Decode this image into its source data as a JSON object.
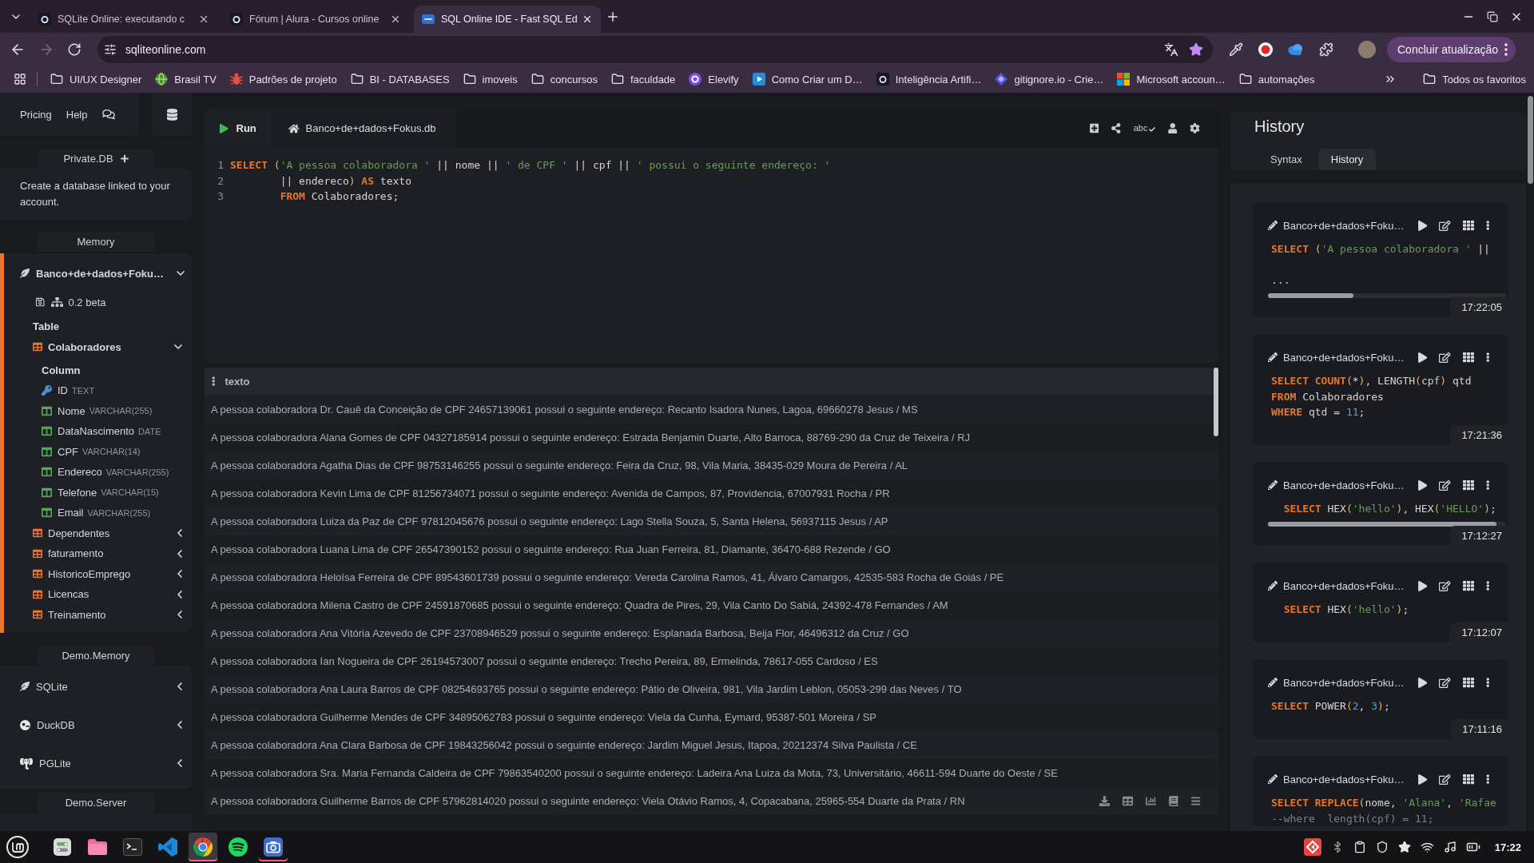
{
  "browser": {
    "tabs": [
      {
        "title": "SQLite Online: executando c",
        "kind": "tile",
        "selected": false
      },
      {
        "title": "Fórum | Alura - Cursos online",
        "kind": "tile",
        "selected": false
      },
      {
        "title": "SQL Online IDE - Fast SQL Ed",
        "kind": "badge",
        "selected": true
      }
    ],
    "forward_disabled": true,
    "address": {
      "url": "sqliteonline.com",
      "bookmarked": true
    },
    "update_button": "Concluir atualização",
    "bookmarks": [
      {
        "label": "UI/UX Designer",
        "kind": "folder"
      },
      {
        "label": "Brasil TV",
        "kind": "globe"
      },
      {
        "label": "Padrões de projeto",
        "kind": "bug"
      },
      {
        "label": "BI - DATABASES",
        "kind": "folder"
      },
      {
        "label": "imoveis",
        "kind": "folder"
      },
      {
        "label": "concursos",
        "kind": "folder"
      },
      {
        "label": "faculdade",
        "kind": "folder"
      },
      {
        "label": "Elevify",
        "kind": "ring"
      },
      {
        "label": "Como Criar um D…",
        "kind": "play"
      },
      {
        "label": "Inteligência Artifi…",
        "kind": "tile"
      },
      {
        "label": "gitignore.io - Crie…",
        "kind": "diamond"
      },
      {
        "label": "Microsoft accoun…",
        "kind": "squares"
      },
      {
        "label": "automações",
        "kind": "folder"
      }
    ],
    "all_bookmarks": "Todos os favoritos"
  },
  "sidebar": {
    "links": [
      "Pricing",
      "Help"
    ],
    "private_db": {
      "title": "Private.DB",
      "text": "Create a database linked to your account."
    },
    "memory": {
      "title": "Memory",
      "database": {
        "name": "Banco+de+dados+Foku…",
        "selected": true,
        "expanded": true,
        "version": "0.2 beta",
        "tables_heading": "Table",
        "tables": [
          {
            "name": "Colaboradores",
            "expanded": true,
            "columns_heading": "Column",
            "columns": [
              {
                "name": "ID",
                "type": "TEXT",
                "kind": "key"
              },
              {
                "name": "Nome",
                "type": "VARCHAR(255)",
                "kind": "field"
              },
              {
                "name": "DataNascimento",
                "type": "DATE",
                "kind": "field"
              },
              {
                "name": "CPF",
                "type": "VARCHAR(14)",
                "kind": "field"
              },
              {
                "name": "Endereco",
                "type": "VARCHAR(255)",
                "kind": "field"
              },
              {
                "name": "Telefone",
                "type": "VARCHAR(15)",
                "kind": "field"
              },
              {
                "name": "Email",
                "type": "VARCHAR(255)",
                "kind": "field"
              }
            ]
          },
          {
            "name": "Dependentes",
            "expanded": false
          },
          {
            "name": "faturamento",
            "expanded": false
          },
          {
            "name": "HistoricoEmprego",
            "expanded": false
          },
          {
            "name": "Licencas",
            "expanded": false
          },
          {
            "name": "Treinamento",
            "expanded": false
          }
        ]
      }
    },
    "demo_memory": {
      "title": "Demo.Memory",
      "engines": [
        {
          "name": "SQLite",
          "kind": "feather",
          "expanded": false
        },
        {
          "name": "DuckDB",
          "kind": "disc",
          "expanded": false
        },
        {
          "name": "PGLite",
          "kind": "elephant",
          "expanded": false
        }
      ]
    },
    "demo_server": {
      "title": "Demo.Server"
    }
  },
  "editor": {
    "run_button": "Run",
    "file_tab": "Banco+de+dados+Fokus.db",
    "tools": [
      {
        "kind": "add"
      },
      {
        "kind": "share"
      },
      {
        "kind": "spellcheck",
        "label": "abc"
      },
      {
        "kind": "user"
      },
      {
        "kind": "settings"
      }
    ],
    "lines": [
      {
        "number": "1",
        "tokens": [
          {
            "text": "SELECT",
            "kind": "keyword"
          },
          {
            "text": " (",
            "kind": "bracket"
          },
          {
            "text": "'A pessoa colaboradora '",
            "kind": "string"
          },
          {
            "text": " || nome || ",
            "kind": "plain"
          },
          {
            "text": "' de CPF '",
            "kind": "string"
          },
          {
            "text": " || cpf || ",
            "kind": "plain"
          },
          {
            "text": "' possui o seguinte endereço: '",
            "kind": "string"
          }
        ]
      },
      {
        "number": "2",
        "tokens": [
          {
            "text": "        || endereco",
            "kind": "plain"
          },
          {
            "text": ")",
            "kind": "bracket"
          },
          {
            "text": " AS",
            "kind": "keyword"
          },
          {
            "text": " texto",
            "kind": "plain"
          }
        ]
      },
      {
        "number": "3",
        "tokens": [
          {
            "text": "        FROM",
            "kind": "keyword"
          },
          {
            "text": " Colaboradores;",
            "kind": "plain"
          }
        ]
      }
    ]
  },
  "results": {
    "column": "texto",
    "rows": [
      "A pessoa colaboradora Dr. Cauê da Conceição de CPF 24657139061 possui o seguinte endereço: Recanto Isadora Nunes, Lagoa, 69660278 Jesus / MS",
      "A pessoa colaboradora Alana Gomes de CPF 04327185914 possui o seguinte endereço: Estrada Benjamin Duarte, Alto Barroca, 88769-290 da Cruz de Teixeira / RJ",
      "A pessoa colaboradora Agatha Dias de CPF 98753146255 possui o seguinte endereço: Feira da Cruz, 98, Vila Maria, 38435-029 Moura de Pereira / AL",
      "A pessoa colaboradora Kevin Lima de CPF 81256734071 possui o seguinte endereço: Avenida de Campos, 87, Providencia, 67007931 Rocha / PR",
      "A pessoa colaboradora Luiza da Paz de CPF 97812045676 possui o seguinte endereço: Lago Stella Souza, 5, Santa Helena, 56937115 Jesus / AP",
      "A pessoa colaboradora Luana Lima de CPF 26547390152 possui o seguinte endereço: Rua Juan Ferreira, 81, Diamante, 36470-688 Rezende / GO",
      "A pessoa colaboradora Heloísa Ferreira de CPF 89543601739 possui o seguinte endereço: Vereda Carolina Ramos, 41, Álvaro Camargos, 42535-583 Rocha de Goiás / PE",
      "A pessoa colaboradora Milena Castro de CPF 24591870685 possui o seguinte endereço: Quadra de Pires, 29, Vila Canto Do Sabiá, 24392-478 Fernandes / AM",
      "A pessoa colaboradora Ana Vitória Azevedo de CPF 23708946529 possui o seguinte endereço: Esplanada Barbosa, Beija Flor, 46496312 da Cruz / GO",
      "A pessoa colaboradora Ian Nogueira de CPF 26194573007 possui o seguinte endereço: Trecho Pereira, 89, Ermelinda, 78617-055 Cardoso / ES",
      "A pessoa colaboradora Ana Laura Barros de CPF 08254693765 possui o seguinte endereço: Pátio de Oliveira, 981, Vila Jardim Leblon, 05053-299 das Neves / TO",
      "A pessoa colaboradora Guilherme Mendes de CPF 34895062783 possui o seguinte endereço: Viela da Cunha, Eymard, 95387-501 Moreira / SP",
      "A pessoa colaboradora Ana Clara Barbosa de CPF 19843256042 possui o seguinte endereço: Jardim Miguel Jesus, Itapoa, 20212374 Silva Paulista / CE",
      "A pessoa colaboradora Sra. Maria Fernanda Caldeira de CPF 79863540200 possui o seguinte endereço: Ladeira Ana Luiza da Mota, 73, Universitário, 46611-594 Duarte do Oeste / SE",
      "A pessoa colaboradora Guilherme Barros de CPF 57962814020 possui o seguinte endereço: Viela Otávio Ramos, 4, Copacabana, 25965-554 Duarte da Prata / RN"
    ],
    "tools": [
      {
        "kind": "download"
      },
      {
        "kind": "table"
      },
      {
        "kind": "chart"
      },
      {
        "kind": "book"
      },
      {
        "kind": "menu"
      }
    ]
  },
  "history": {
    "title": "History",
    "tabs": [
      {
        "label": "Syntax",
        "selected": false
      },
      {
        "label": "History",
        "selected": true
      }
    ],
    "entries": [
      {
        "database": "Banco+de+dados+Foku…",
        "scrollbar": true,
        "time": "17:22:05",
        "more": "...",
        "lines": [
          [
            {
              "text": "SELECT",
              "kind": "keyword"
            },
            {
              "text": " (",
              "kind": "bracket"
            },
            {
              "text": "'A pessoa colaboradora '",
              "kind": "string"
            },
            {
              "text": " ||",
              "kind": "plain"
            }
          ]
        ]
      },
      {
        "database": "Banco+de+dados+Foku…",
        "scrollbar": false,
        "time": "17:21:36",
        "lines": [
          [
            {
              "text": "SELECT",
              "kind": "keyword"
            },
            {
              "text": " COUNT",
              "kind": "keyword"
            },
            {
              "text": "(",
              "kind": "bracket"
            },
            {
              "text": "*",
              "kind": "plain"
            },
            {
              "text": ")",
              "kind": "bracket"
            },
            {
              "text": ", LENGTH",
              "kind": "plain"
            },
            {
              "text": "(",
              "kind": "bracket"
            },
            {
              "text": "cpf",
              "kind": "plain"
            },
            {
              "text": ")",
              "kind": "bracket"
            },
            {
              "text": " qtd",
              "kind": "plain"
            }
          ],
          [
            {
              "text": "FROM",
              "kind": "keyword"
            },
            {
              "text": " Colaboradores",
              "kind": "plain"
            }
          ],
          [
            {
              "text": "WHERE",
              "kind": "keyword"
            },
            {
              "text": " qtd = ",
              "kind": "plain"
            },
            {
              "text": "11",
              "kind": "number"
            },
            {
              "text": ";",
              "kind": "plain"
            }
          ]
        ]
      },
      {
        "database": "Banco+de+dados+Foku…",
        "scrollbar": true,
        "time": "17:12:27",
        "lines": [
          [
            {
              "text": "  SELECT",
              "kind": "keyword"
            },
            {
              "text": " HEX",
              "kind": "plain"
            },
            {
              "text": "(",
              "kind": "bracket"
            },
            {
              "text": "'hello'",
              "kind": "string"
            },
            {
              "text": ")",
              "kind": "bracket"
            },
            {
              "text": ", HEX",
              "kind": "plain"
            },
            {
              "text": "(",
              "kind": "bracket"
            },
            {
              "text": "'HELLO'",
              "kind": "string"
            },
            {
              "text": ")",
              "kind": "bracket"
            },
            {
              "text": ";",
              "kind": "plain"
            }
          ]
        ]
      },
      {
        "database": "Banco+de+dados+Foku…",
        "scrollbar": false,
        "time": "17:12:07",
        "lines": [
          [
            {
              "text": "  SELECT",
              "kind": "keyword"
            },
            {
              "text": " HEX",
              "kind": "plain"
            },
            {
              "text": "(",
              "kind": "bracket"
            },
            {
              "text": "'hello'",
              "kind": "string"
            },
            {
              "text": ")",
              "kind": "bracket"
            },
            {
              "text": ";",
              "kind": "plain"
            }
          ]
        ]
      },
      {
        "database": "Banco+de+dados+Foku…",
        "scrollbar": false,
        "time": "17:11:16",
        "lines": [
          [
            {
              "text": "SELECT",
              "kind": "keyword"
            },
            {
              "text": " POWER",
              "kind": "plain"
            },
            {
              "text": "(",
              "kind": "bracket"
            },
            {
              "text": "2",
              "kind": "number"
            },
            {
              "text": ", ",
              "kind": "plain"
            },
            {
              "text": "3",
              "kind": "number"
            },
            {
              "text": ")",
              "kind": "bracket"
            },
            {
              "text": ";",
              "kind": "plain"
            }
          ]
        ]
      },
      {
        "database": "Banco+de+dados+Foku…",
        "scrollbar": false,
        "lines": [
          [
            {
              "text": "SELECT",
              "kind": "keyword"
            },
            {
              "text": " REPLACE",
              "kind": "keyword"
            },
            {
              "text": "(",
              "kind": "bracket"
            },
            {
              "text": "nome, ",
              "kind": "plain"
            },
            {
              "text": "'Alana'",
              "kind": "string"
            },
            {
              "text": ", ",
              "kind": "plain"
            },
            {
              "text": "'Rafae",
              "kind": "string"
            }
          ],
          [
            {
              "text": "--where  length(cpf) = 11;",
              "kind": "comment"
            }
          ]
        ]
      }
    ]
  },
  "taskbar": {
    "apps": [
      {
        "kind": "settings",
        "selected": false,
        "running": false
      },
      {
        "kind": "files",
        "selected": false,
        "running": false
      },
      {
        "kind": "terminal",
        "selected": false,
        "running": false
      },
      {
        "kind": "editor",
        "selected": false,
        "running": false
      },
      {
        "kind": "browser",
        "selected": true,
        "running": true
      },
      {
        "kind": "music",
        "selected": false,
        "running": false
      },
      {
        "kind": "camera",
        "selected": false,
        "running": true
      }
    ],
    "clock": "17:22"
  }
}
